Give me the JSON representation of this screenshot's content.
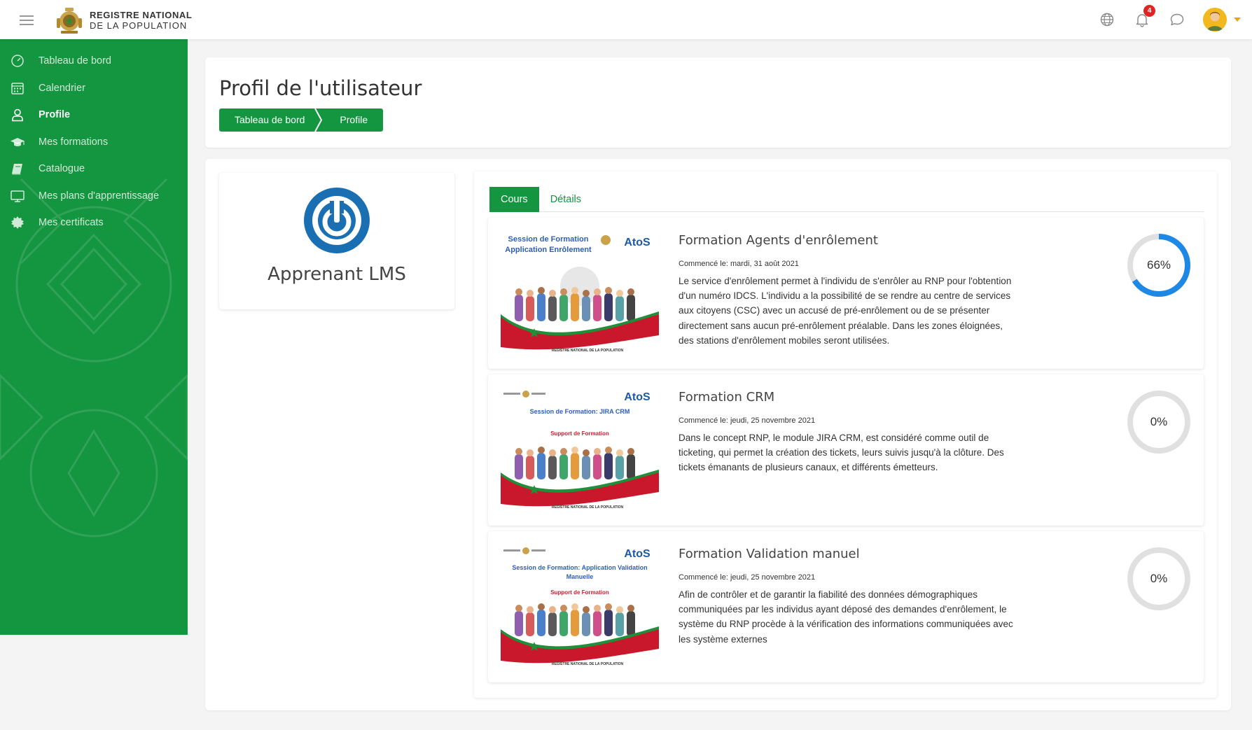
{
  "header": {
    "logo_line1": "REGISTRE NATIONAL",
    "logo_line2": "DE LA POPULATION",
    "notifications_count": "4",
    "icons": [
      "menu-icon",
      "globe-icon",
      "bell-icon",
      "chat-icon",
      "user-avatar",
      "caret-down-icon"
    ]
  },
  "sidebar": {
    "items": [
      {
        "label": "Tableau de bord",
        "icon": "dashboard-icon",
        "active": false
      },
      {
        "label": "Calendrier",
        "icon": "calendar-icon",
        "active": false
      },
      {
        "label": "Profile",
        "icon": "user-icon",
        "active": true
      },
      {
        "label": "Mes formations",
        "icon": "graduation-cap-icon",
        "active": false
      },
      {
        "label": "Catalogue",
        "icon": "book-icon",
        "active": false
      },
      {
        "label": "Mes plans d'apprentissage",
        "icon": "monitor-icon",
        "active": false
      },
      {
        "label": "Mes certificats",
        "icon": "certificate-icon",
        "active": false
      }
    ]
  },
  "page": {
    "title": "Profil de l'utilisateur",
    "breadcrumb": [
      "Tableau de bord",
      "Profile"
    ]
  },
  "profile": {
    "name": "Apprenant LMS"
  },
  "tabs": [
    "Cours",
    "Détails"
  ],
  "thumbnails": {
    "brand": "AtoS",
    "t1_line1": "Session de Formation",
    "t1_line2": "Application Enrôlement",
    "t2_title": "Session de Formation: JIRA CRM",
    "t3_title_1": "Session de Formation: Application Validation",
    "t3_title_2": "Manuelle",
    "support": "Support de Formation",
    "footer": "REGISTRE NATIONAL DE LA POPULATION"
  },
  "courses": [
    {
      "title": "Formation Agents d'enrôlement",
      "date": "Commencé le: mardi, 31 août 2021",
      "description": "Le service d'enrôlement permet à l'individu de s'enrôler au RNP pour l'obtention d'un numéro IDCS. L'individu a la possibilité de se rendre au centre de services aux citoyens (CSC) avec un accusé de pré-enrôlement ou de se présenter directement sans aucun pré-enrôlement préalable. Dans les zones éloignées, des stations d'enrôlement mobiles seront utilisées.",
      "progress": 66,
      "progress_label": "66%"
    },
    {
      "title": "Formation CRM",
      "date": "Commencé le: jeudi, 25 novembre 2021",
      "description": "Dans le concept RNP, le module JIRA CRM, est considéré comme outil de ticketing, qui permet la création des tickets, leurs suivis jusqu'à la clôture. Des tickets émanants de plusieurs canaux, et différents émetteurs.",
      "progress": 0,
      "progress_label": "0%"
    },
    {
      "title": "Formation Validation manuel",
      "date": "Commencé le: jeudi, 25 novembre 2021",
      "description": "Afin de contrôler et de garantir la fiabilité des données démographiques communiquées par les individus ayant déposé des demandes d'enrôlement, le système du RNP procède à la vérification des informations communiquées avec les système externes",
      "progress": 0,
      "progress_label": "0%"
    }
  ],
  "colors": {
    "primary_green": "#14953f",
    "progress_blue": "#1e88e5",
    "progress_track": "#e0e0e0",
    "badge_red": "#e02424"
  }
}
